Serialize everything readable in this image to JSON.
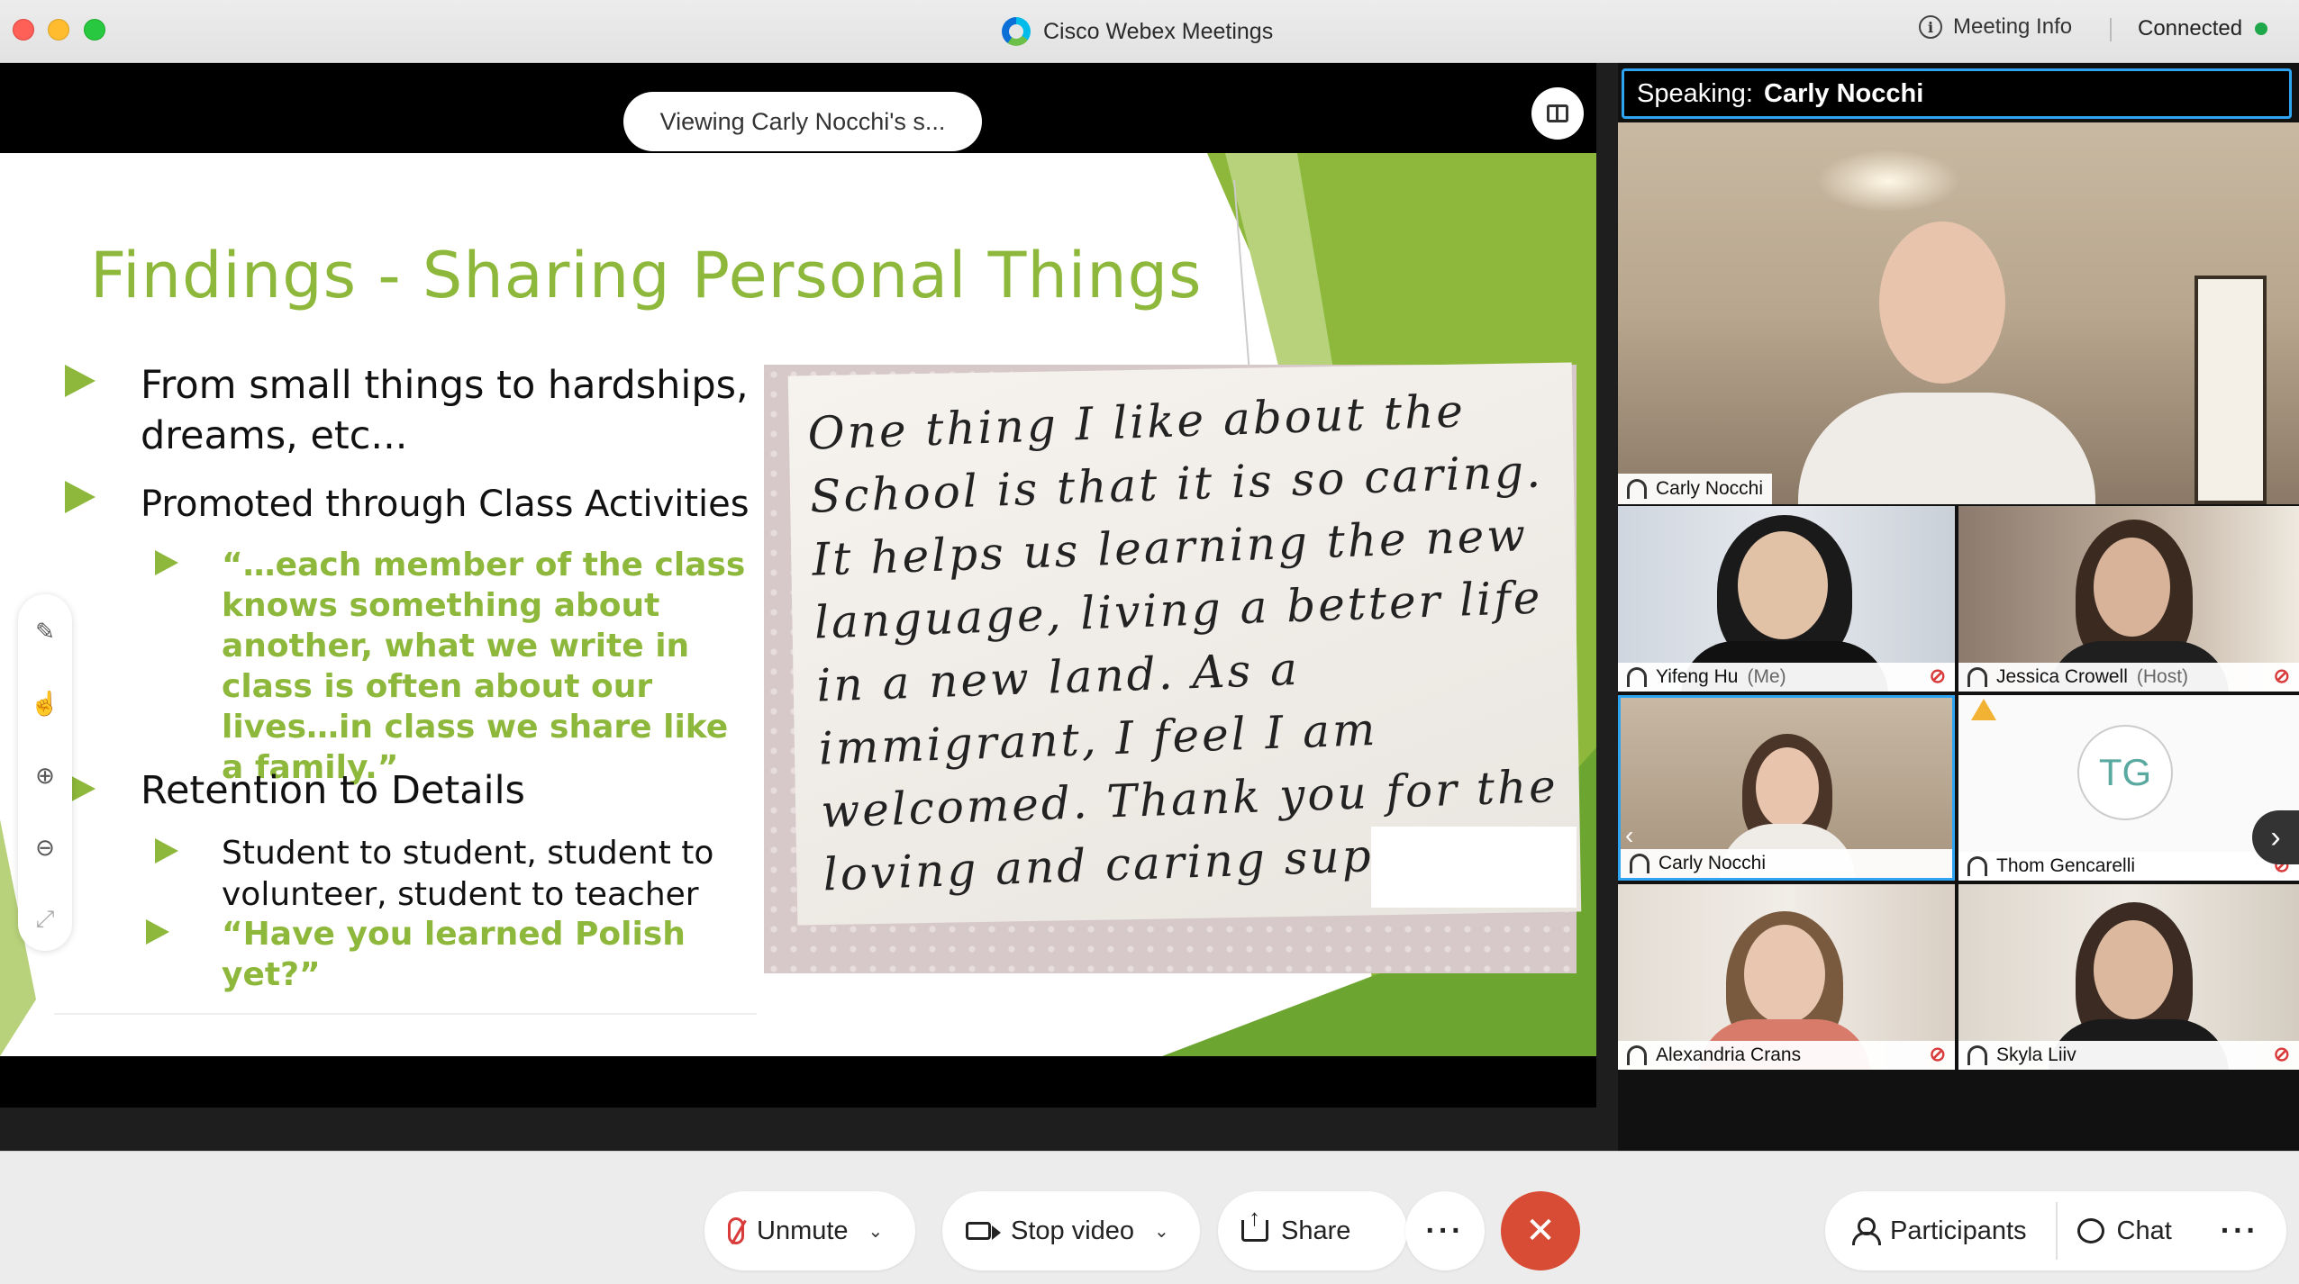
{
  "window": {
    "title": "Cisco Webex Meetings",
    "meeting_info": "Meeting Info",
    "status": "Connected"
  },
  "share": {
    "viewing_label": "Viewing Carly Nocchi's s...",
    "slide": {
      "title": "Findings - Sharing Personal Things",
      "bullets": [
        "From small things to hardships, dreams, etc...",
        "Promoted through Class Activities",
        "“…each member of the class knows something about another, what we write in class is often about our lives…in class we share like a family.”",
        "Retention to Details",
        "Student to student, student to volunteer,  student to teacher",
        "“Have you learned Polish yet?”"
      ],
      "handwritten_note": "One thing I like about the School is that it is so caring. It helps us learning the new language, living a better life in a new land. As a immigrant, I feel I am welcomed. Thank you for the loving and caring support!"
    }
  },
  "panel": {
    "speaking_prefix": "Speaking:",
    "speaking_name": "Carly Nocchi",
    "main_video_name": "Carly Nocchi",
    "participants": [
      {
        "name": "Yifeng Hu",
        "role": "(Me)",
        "muted": true
      },
      {
        "name": "Jessica Crowell",
        "role": "(Host)",
        "muted": true
      },
      {
        "name": "Carly Nocchi",
        "role": "",
        "muted": false
      },
      {
        "name": "Thom Gencarelli",
        "role": "",
        "muted": true,
        "initials": "TG"
      },
      {
        "name": "Alexandria Crans",
        "role": "",
        "muted": true
      },
      {
        "name": "Skyla Liiv",
        "role": "",
        "muted": true
      }
    ]
  },
  "controls": {
    "unmute": "Unmute",
    "stop_video": "Stop video",
    "share": "Share",
    "participants": "Participants",
    "chat": "Chat"
  },
  "icons": {
    "close_window": "close-icon",
    "minimize_window": "minimize-icon",
    "fullscreen_window": "fullscreen-icon",
    "mute_state": "mic-muted-icon",
    "annotation_tools": [
      "pen-icon",
      "pointer-icon",
      "zoom-in-icon",
      "zoom-out-icon",
      "fit-icon"
    ]
  },
  "colors": {
    "accent_green": "#8db83b",
    "active_speaker_border": "#2ea4f2",
    "end_meeting": "#d84b34",
    "muted_red": "#d93b3b",
    "connected_dot": "#1ea84a"
  }
}
